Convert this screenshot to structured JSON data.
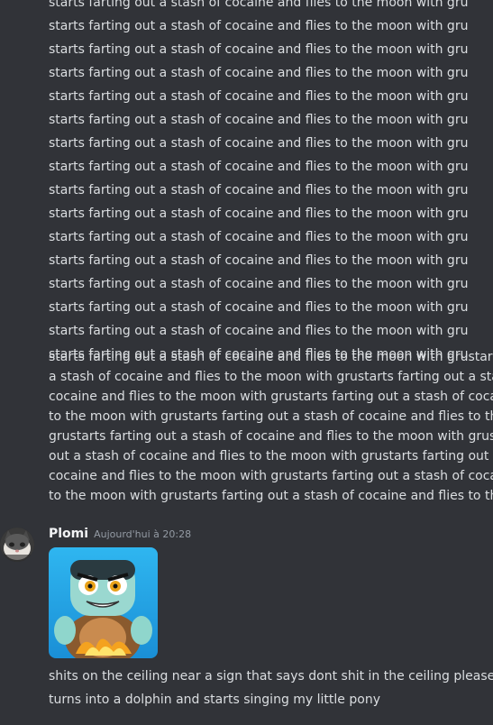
{
  "repeated_messages": [
    "starts farting out a stash of cocaine and flies to the moon with gru",
    "starts farting out a stash of cocaine and flies to the moon with gru",
    "starts farting out a stash of cocaine and flies to the moon with gru",
    "starts farting out a stash of cocaine and flies to the moon with gru",
    "starts farting out a stash of cocaine and flies to the moon with gru",
    "starts farting out a stash of cocaine and flies to the moon with gru",
    "starts farting out a stash of cocaine and flies to the moon with gru",
    "starts farting out a stash of cocaine and flies to the moon with gru",
    "starts farting out a stash of cocaine and flies to the moon with gru",
    "starts farting out a stash of cocaine and flies to the moon with gru",
    "starts farting out a stash of cocaine and flies to the moon with gru",
    "starts farting out a stash of cocaine and flies to the moon with gru",
    "starts farting out a stash of cocaine and flies to the moon with gru",
    "starts farting out a stash of cocaine and flies to the moon with gru",
    "starts farting out a stash of cocaine and flies to the moon with gru",
    "starts farting out a stash of cocaine and flies to the moon with gru"
  ],
  "long_message_lines": [
    "starts farting out a stash of cocaine and flies to the moon with grustarts farting out",
    "a stash of cocaine and flies to the moon with grustarts farting out a stash of",
    "cocaine and flies to the moon with grustarts farting out a stash of cocaine and flies",
    "to the moon with grustarts farting out a stash of cocaine and flies to the moon with",
    "grustarts farting out a stash of cocaine and flies to the moon with grustarts farting",
    "out a stash of cocaine and flies to the moon with grustarts farting out a stash of",
    "cocaine and flies to the moon with grustarts farting out a stash of cocaine and flies",
    "to the moon with grustarts farting out a stash of cocaine and flies to the moon with"
  ],
  "message": {
    "author": "Plomi",
    "timestamp": "Aujourd'hui à 20:28",
    "lines": [
      "shits on the ceiling near a sign that says dont shit in the ceiling please",
      "turns into  a dolphin and starts singing my little pony"
    ]
  },
  "colors": {
    "background": "#313338",
    "text": "#dbdee1",
    "author": "#f2f3f5",
    "timestamp": "#949ba4"
  },
  "icons": {
    "avatar": "cat-avatar",
    "attachment": "game-character-image"
  }
}
